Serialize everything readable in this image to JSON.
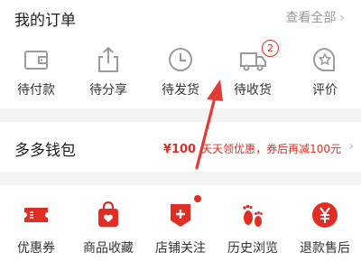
{
  "orders": {
    "title": "我的订单",
    "view_all": "查看全部",
    "items": [
      {
        "label": "待付款",
        "icon": "wallet-icon"
      },
      {
        "label": "待分享",
        "icon": "share-icon"
      },
      {
        "label": "待发货",
        "icon": "clock-icon"
      },
      {
        "label": "待收货",
        "icon": "delivery-truck-icon",
        "badge": "2"
      },
      {
        "label": "评价",
        "icon": "review-icon"
      }
    ]
  },
  "wallet": {
    "title": "多多钱包",
    "promo_amount": "¥100",
    "promo_text": "天天领优惠，券后再减100元"
  },
  "services": {
    "items": [
      {
        "label": "优惠券",
        "icon": "coupon-icon"
      },
      {
        "label": "商品收藏",
        "icon": "favorite-bag-icon"
      },
      {
        "label": "店铺关注",
        "icon": "store-follow-icon"
      },
      {
        "label": "历史浏览",
        "icon": "footprints-icon"
      },
      {
        "label": "退款售后",
        "icon": "refund-icon"
      }
    ]
  },
  "colors": {
    "accent": "#e02e24",
    "icon_gray": "#9a9a9a",
    "annotation_arrow": "#e53935"
  }
}
